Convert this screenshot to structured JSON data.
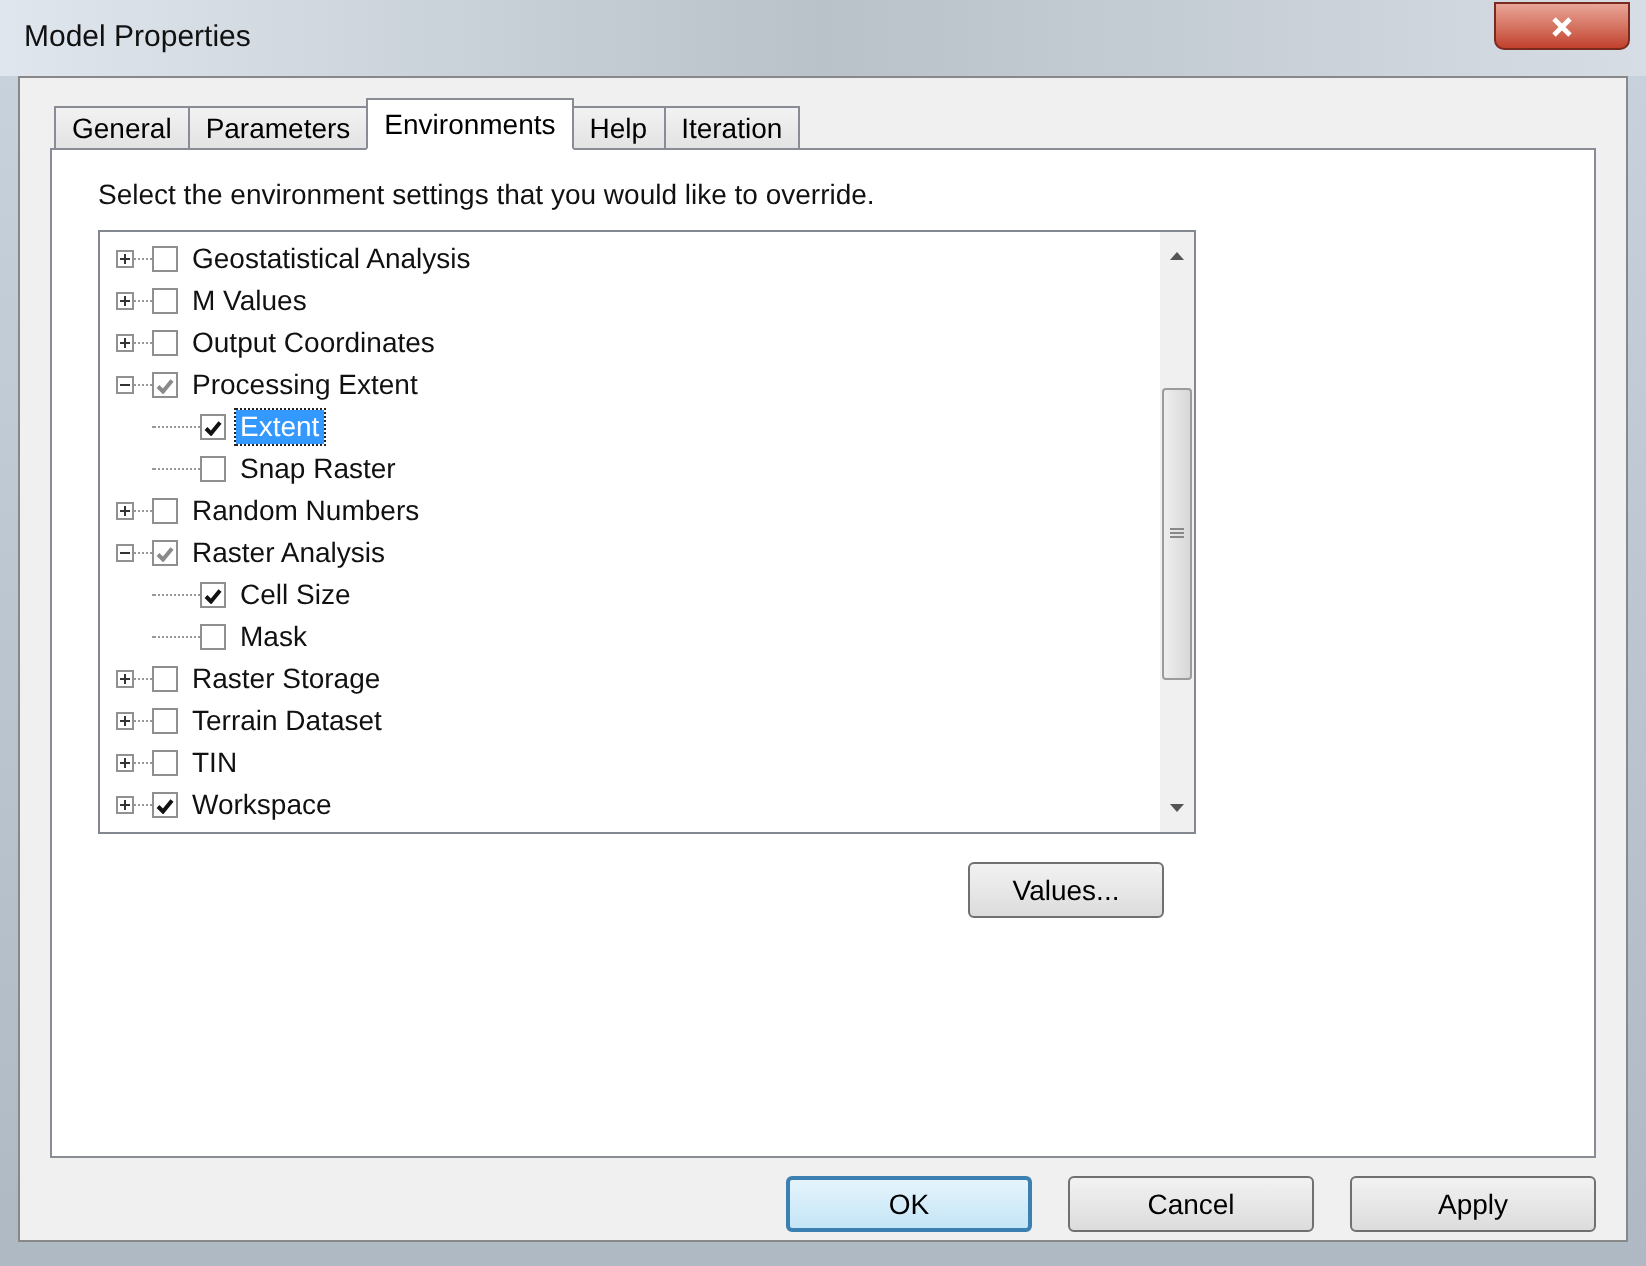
{
  "window": {
    "title": "Model Properties"
  },
  "tabs": [
    {
      "label": "General",
      "selected": false
    },
    {
      "label": "Parameters",
      "selected": false
    },
    {
      "label": "Environments",
      "selected": true
    },
    {
      "label": "Help",
      "selected": false
    },
    {
      "label": "Iteration",
      "selected": false
    }
  ],
  "instruction": "Select the environment settings that you would like to override.",
  "tree": [
    {
      "label": "Geostatistical Analysis",
      "checked": false,
      "expanded": false,
      "selected": false
    },
    {
      "label": "M Values",
      "checked": false,
      "expanded": false,
      "selected": false
    },
    {
      "label": "Output Coordinates",
      "checked": false,
      "expanded": false,
      "selected": false
    },
    {
      "label": "Processing Extent",
      "checked": true,
      "dimmed": true,
      "expanded": true,
      "selected": false,
      "children": [
        {
          "label": "Extent",
          "checked": true,
          "dimmed": false,
          "selected": true
        },
        {
          "label": "Snap Raster",
          "checked": false,
          "selected": false
        }
      ]
    },
    {
      "label": "Random Numbers",
      "checked": false,
      "expanded": false,
      "selected": false
    },
    {
      "label": "Raster Analysis",
      "checked": true,
      "dimmed": true,
      "expanded": true,
      "selected": false,
      "children": [
        {
          "label": "Cell Size",
          "checked": true,
          "dimmed": false,
          "selected": false
        },
        {
          "label": "Mask",
          "checked": false,
          "selected": false
        }
      ]
    },
    {
      "label": "Raster Storage",
      "checked": false,
      "expanded": false,
      "selected": false
    },
    {
      "label": "Terrain Dataset",
      "checked": false,
      "expanded": false,
      "selected": false
    },
    {
      "label": "TIN",
      "checked": false,
      "expanded": false,
      "selected": false
    },
    {
      "label": "Workspace",
      "checked": true,
      "dimmed": false,
      "expanded": false,
      "selected": false
    }
  ],
  "values_button": "Values...",
  "buttons": [
    {
      "label": "OK",
      "kind": "default"
    },
    {
      "label": "Cancel",
      "kind": "normal"
    },
    {
      "label": "Apply",
      "kind": "normal"
    }
  ]
}
